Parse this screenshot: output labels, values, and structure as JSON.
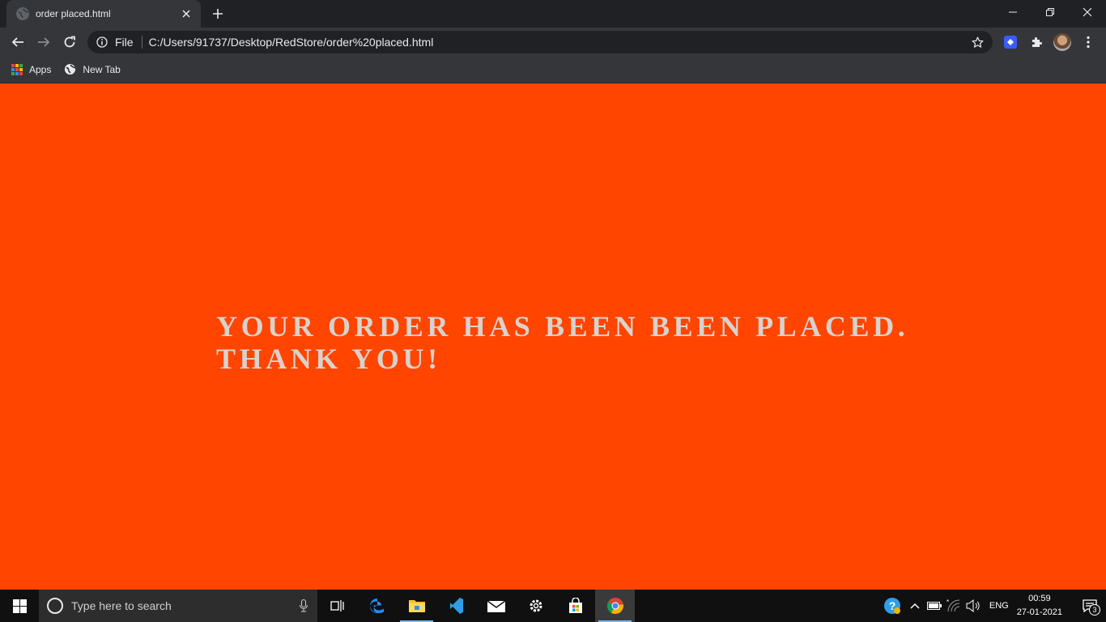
{
  "browser": {
    "tab": {
      "title": "order placed.html",
      "favicon": "globe-icon"
    },
    "omnibox": {
      "scheme_label": "File",
      "url": "C:/Users/91737/Desktop/RedStore/order%20placed.html"
    },
    "bookmarks": [
      {
        "label": "Apps",
        "icon": "apps-grid-icon"
      },
      {
        "label": "New Tab",
        "icon": "globe-icon"
      }
    ]
  },
  "page": {
    "background": "#ff4500",
    "text_color": "#d9d2cc",
    "message_line1": "YOUR ORDER HAS BEEN BEEN PLACED.",
    "message_line2": "THANK YOU!"
  },
  "taskbar": {
    "search_placeholder": "Type here to search",
    "apps": [
      "task-view-icon",
      "edge-icon",
      "file-explorer-icon",
      "vscode-icon",
      "mail-icon",
      "settings-icon",
      "store-icon",
      "chrome-icon"
    ],
    "tray": {
      "language": "ENG",
      "time": "00:59",
      "date": "27-01-2021",
      "notification_count": "3"
    }
  }
}
